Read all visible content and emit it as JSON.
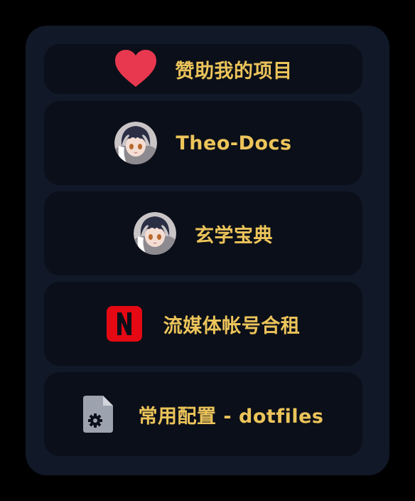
{
  "links": [
    {
      "label": "赞助我的项目",
      "icon": "heart-icon"
    },
    {
      "label": "Theo-Docs",
      "icon": "anime-avatar-icon"
    },
    {
      "label": "玄学宝典",
      "icon": "anime-avatar-icon"
    },
    {
      "label": "流媒体帐号合租",
      "icon": "netflix-logo-icon"
    },
    {
      "label": "常用配置 - dotfiles",
      "icon": "file-settings-icon"
    }
  ],
  "colors": {
    "background": "#000000",
    "panel": "#111827",
    "card": "#0b0f19",
    "label": "#ecc45a",
    "heart": "#e8384f",
    "netflix": "#e50914",
    "file_icon": "#9ca3af"
  }
}
